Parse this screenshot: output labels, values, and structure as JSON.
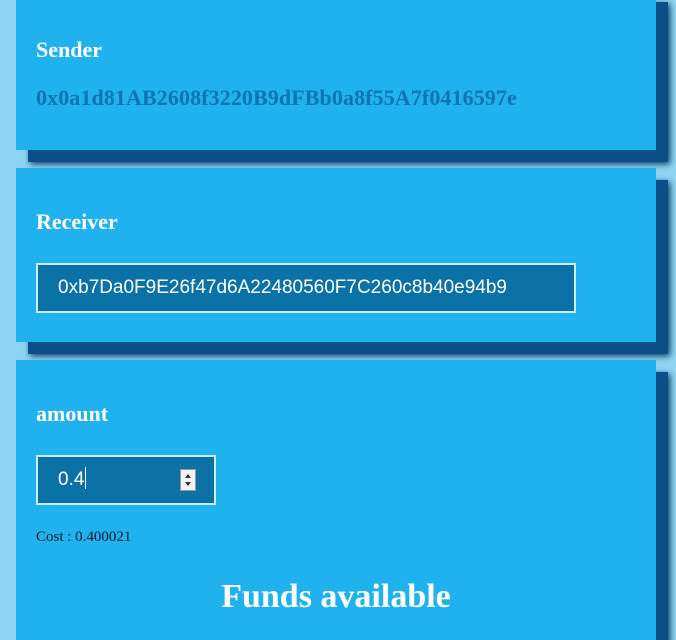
{
  "sender": {
    "label": "Sender",
    "address": "0x0a1d81AB2608f3220B9dFBb0a8f55A7f0416597e"
  },
  "receiver": {
    "label": "Receiver",
    "value": "0xb7Da0F9E26f47d6A22480560F7C260c8b40e94b9"
  },
  "amount": {
    "label": "amount",
    "value": "0.4"
  },
  "cost": {
    "text": "Cost : 0.400021"
  },
  "funds": {
    "heading": "Funds available"
  },
  "colors": {
    "card_bg": "#20b2ef",
    "page_bg": "#8fd4f2",
    "shadow": "#0a4f86",
    "input_bg": "#0a72a6",
    "address_text": "#0a75b0"
  }
}
